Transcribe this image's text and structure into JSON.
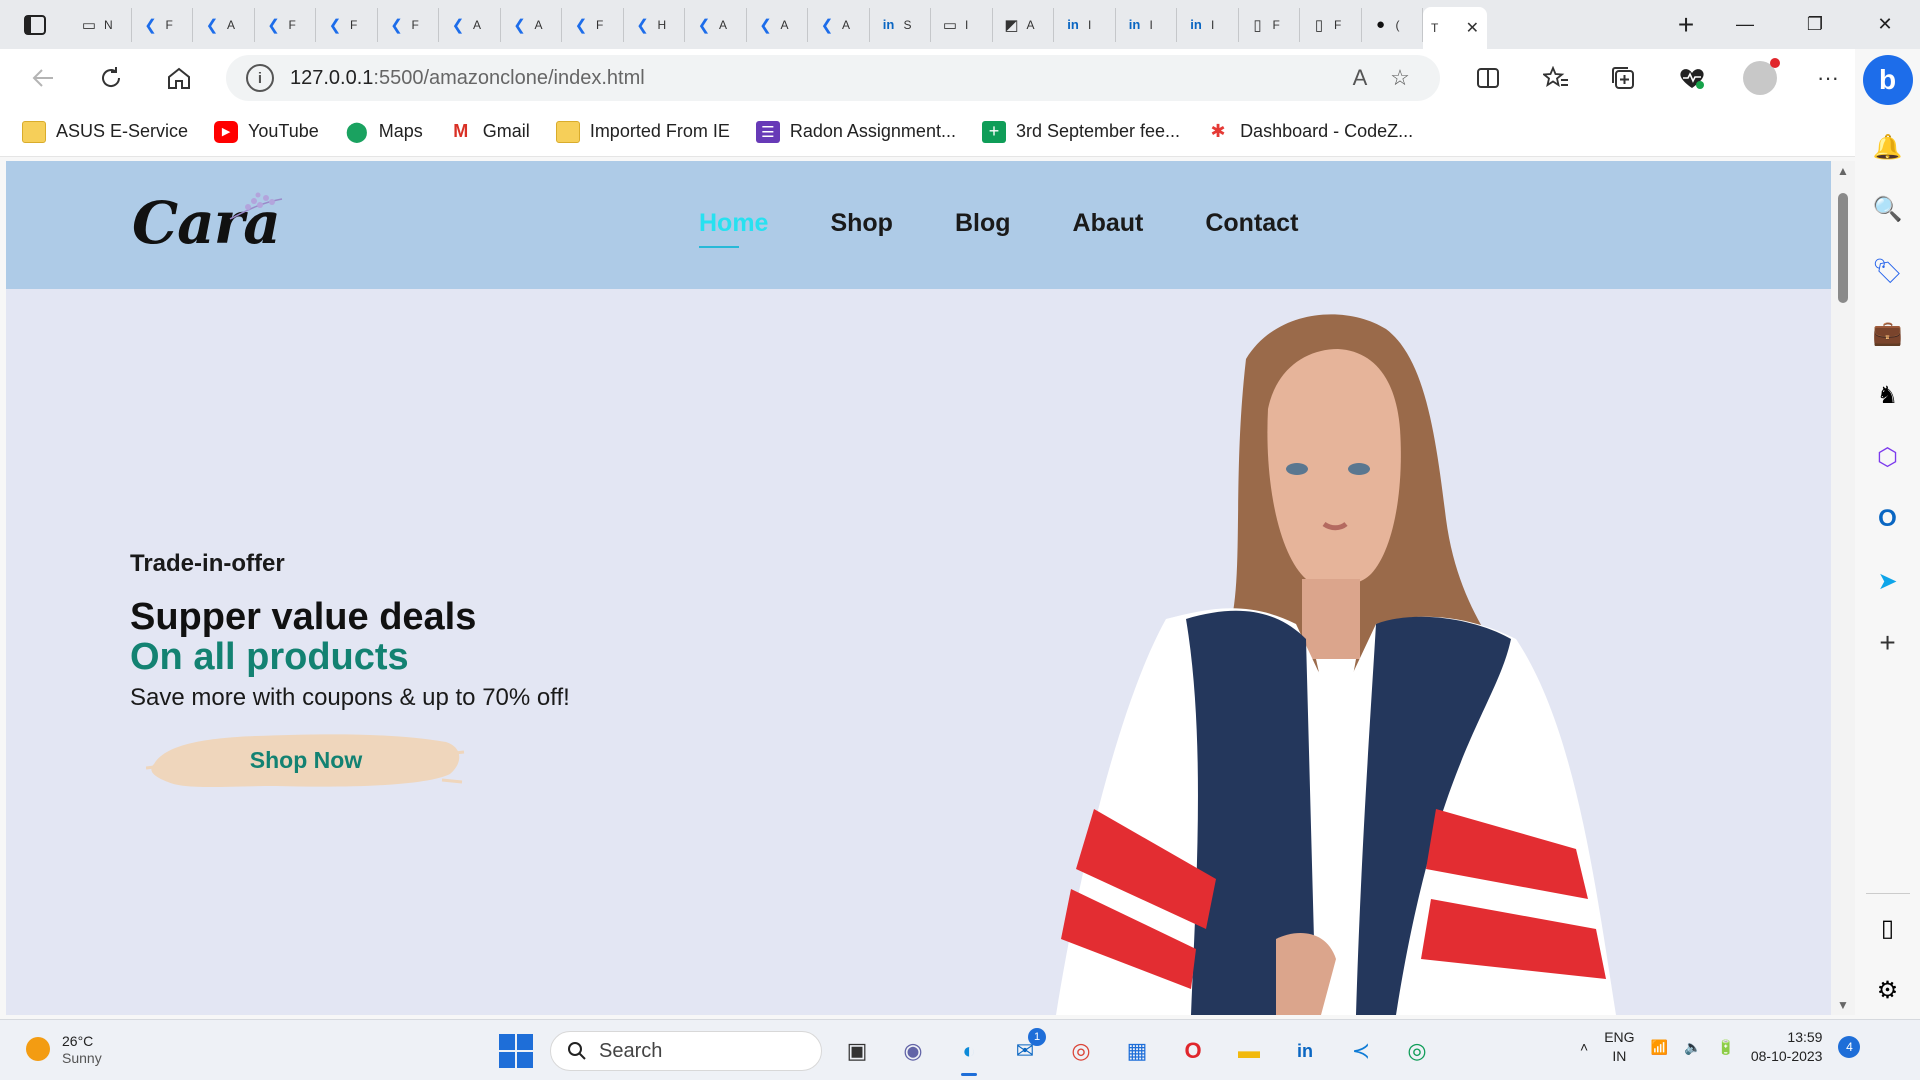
{
  "browser": {
    "tabs": [
      {
        "icon": "▭",
        "label": "N"
      },
      {
        "icon": "❮",
        "label": "F"
      },
      {
        "icon": "❮",
        "label": "A"
      },
      {
        "icon": "❮",
        "label": "F"
      },
      {
        "icon": "❮",
        "label": "F"
      },
      {
        "icon": "❮",
        "label": "F"
      },
      {
        "icon": "❮",
        "label": "A"
      },
      {
        "icon": "❮",
        "label": "A"
      },
      {
        "icon": "❮",
        "label": "F"
      },
      {
        "icon": "❮",
        "label": "H"
      },
      {
        "icon": "❮",
        "label": "A"
      },
      {
        "icon": "❮",
        "label": "A"
      },
      {
        "icon": "❮",
        "label": "A"
      },
      {
        "icon": "in",
        "label": "S"
      },
      {
        "icon": "▭",
        "label": "I"
      },
      {
        "icon": "◩",
        "label": "A"
      },
      {
        "icon": "in",
        "label": "I"
      },
      {
        "icon": "in",
        "label": "I"
      },
      {
        "icon": "in",
        "label": "I"
      },
      {
        "icon": "▯",
        "label": "F"
      },
      {
        "icon": "▯",
        "label": "F"
      },
      {
        "icon": "●",
        "label": "("
      }
    ],
    "active_tab": {
      "label": "T",
      "close": "✕"
    },
    "new_tab": "+",
    "window": {
      "minimize": "—",
      "restore": "❐",
      "close": "✕"
    },
    "url_host": "127.0.0.1",
    "url_path": ":5500/amazonclone/index.html",
    "read_aloud": "A",
    "favorite": "☆"
  },
  "favorites": [
    {
      "icon": "folder",
      "label": "ASUS E-Service"
    },
    {
      "icon": "yt",
      "label": "YouTube"
    },
    {
      "icon": "maps",
      "label": "Maps"
    },
    {
      "icon": "gmail",
      "label": "Gmail"
    },
    {
      "icon": "folder",
      "label": "Imported From IE"
    },
    {
      "icon": "forms",
      "label": "Radon Assignment..."
    },
    {
      "icon": "sheets",
      "label": "3rd September fee..."
    },
    {
      "icon": "codez",
      "label": "Dashboard - CodeZ..."
    }
  ],
  "site": {
    "logo": "Cara",
    "nav": [
      "Home",
      "Shop",
      "Blog",
      "Abaut",
      "Contact"
    ],
    "hero": {
      "kicker": "Trade-in-offer",
      "headline": "Supper value deals",
      "highlight": "On all products",
      "subtitle": "Save more with coupons & up to 70% off!",
      "cta": "Shop Now"
    }
  },
  "taskbar": {
    "weather_temp": "26°C",
    "weather_desc": "Sunny",
    "search": "Search",
    "mail_badge": "1",
    "lang": "ENG",
    "region": "IN",
    "time": "13:59",
    "date": "08-10-2023",
    "notifications": "4"
  },
  "colors": {
    "header_bg": "#aecbe7",
    "hero_bg": "#e3e6f3",
    "accent": "#138272",
    "nav_active": "#27e1f0",
    "cta_stroke": "#efd6bc"
  }
}
